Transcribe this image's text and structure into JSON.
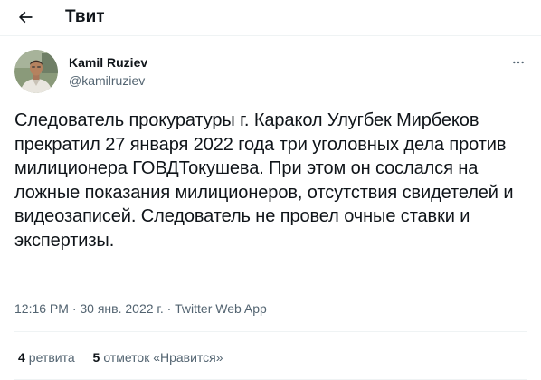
{
  "header": {
    "title": "Твит",
    "back_icon": "arrow-left-icon"
  },
  "tweet": {
    "author": {
      "name": "Kamil Ruziev",
      "handle": "@kamilruziev"
    },
    "text": "Следователь прокуратуры г. Каракол Улугбек Мирбеков прекратил 27 января 2022 года три уголовных дела против милиционера ГОВДТокушева. При этом он сослался на ложные показания милиционеров, отсутствия свидетелей и видеозаписей. Следователь не провел очные ставки и экспертизы.",
    "time": "12:16 PM",
    "date": "30 янв. 2022 г.",
    "separator": "·",
    "source": "Twitter Web App",
    "more_icon": "more-horizontal-icon"
  },
  "stats": {
    "retweets_count": "4",
    "retweets_label": "ретвита",
    "likes_count": "5",
    "likes_label": "отметок «Нравится»"
  },
  "colors": {
    "text_primary": "#0f1419",
    "text_secondary": "#536471",
    "divider": "#eff3f4"
  }
}
